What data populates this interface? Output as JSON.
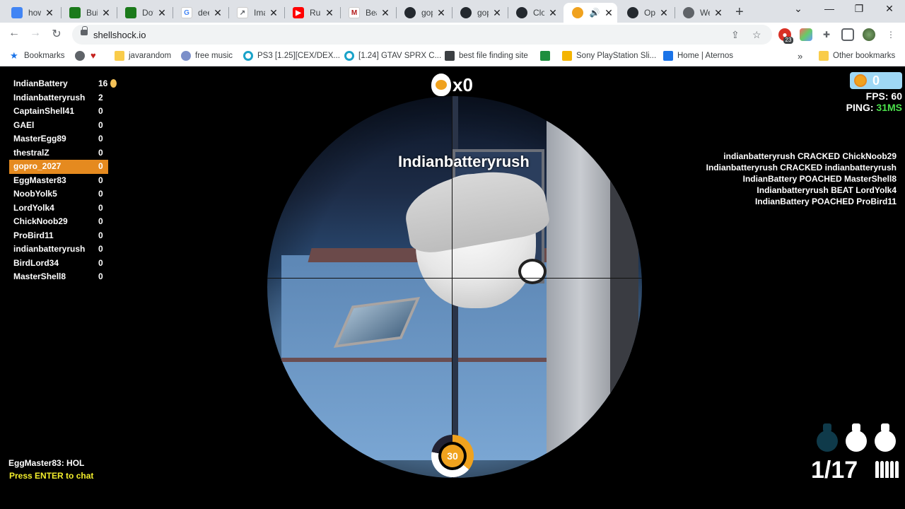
{
  "tabs": [
    {
      "label": "how",
      "color": "#4285f4"
    },
    {
      "label": "Buil",
      "color": "#1b7a1b"
    },
    {
      "label": "Dov",
      "color": "#1b7a1b"
    },
    {
      "label": "dee",
      "color": "#4285f4"
    },
    {
      "label": "Ima",
      "color": "#5f6368"
    },
    {
      "label": "Run",
      "color": "#ff0000"
    },
    {
      "label": "Bea",
      "color": "#b31b1b"
    },
    {
      "label": "gop",
      "color": "#24292f"
    },
    {
      "label": "gop",
      "color": "#24292f"
    },
    {
      "label": "Clo",
      "color": "#24292f"
    },
    {
      "label": "",
      "color": "#f0a21e"
    },
    {
      "label": "Op",
      "color": "#24292f"
    },
    {
      "label": "Wel",
      "color": "#5f6368"
    }
  ],
  "browser": {
    "url": "shellshock.io",
    "extension_badge": "23"
  },
  "bookmarks": [
    {
      "label": "Bookmarks"
    },
    {
      "label": "javarandom"
    },
    {
      "label": "free music"
    },
    {
      "label": "PS3 [1.25][CEX/DEX..."
    },
    {
      "label": "[1.24] GTAV SPRX C..."
    },
    {
      "label": "best file finding site"
    },
    {
      "label": "Sony PlayStation Sli..."
    },
    {
      "label": "Home | Aternos"
    },
    {
      "label": "Other bookmarks"
    }
  ],
  "game": {
    "kill_count": "x0",
    "target_name": "Indianbatteryrush",
    "coins": "0",
    "fps_label": "FPS: 60",
    "ping_label": "PING:",
    "ping_value": "31MS",
    "health": "30",
    "ammo": "1/17",
    "chat_message": "EggMaster83: HOL",
    "chat_hint": "Press ENTER to chat",
    "grenades": [
      "#0f3a4a",
      "#ffffff",
      "#ffffff"
    ]
  },
  "leaderboard": [
    {
      "name": "IndianBattery",
      "score": "16"
    },
    {
      "name": "Indianbatteryrush",
      "score": "2"
    },
    {
      "name": "CaptainShell41",
      "score": "0"
    },
    {
      "name": "GAEl",
      "score": "0"
    },
    {
      "name": "MasterEgg89",
      "score": "0"
    },
    {
      "name": "thestralZ",
      "score": "0"
    },
    {
      "name": "gopro_2027",
      "score": "0"
    },
    {
      "name": "EggMaster83",
      "score": "0"
    },
    {
      "name": "NoobYolk5",
      "score": "0"
    },
    {
      "name": "LordYolk4",
      "score": "0"
    },
    {
      "name": "ChickNoob29",
      "score": "0"
    },
    {
      "name": "ProBird11",
      "score": "0"
    },
    {
      "name": "indianbatteryrush",
      "score": "0"
    },
    {
      "name": "BirdLord34",
      "score": "0"
    },
    {
      "name": "MasterShell8",
      "score": "0"
    }
  ],
  "kill_feed": [
    "indianbatteryrush CRACKED ChickNoob29",
    "Indianbatteryrush CRACKED indianbatteryrush",
    "IndianBattery POACHED MasterShell8",
    "Indianbatteryrush BEAT LordYolk4",
    "IndianBattery POACHED ProBird11"
  ]
}
